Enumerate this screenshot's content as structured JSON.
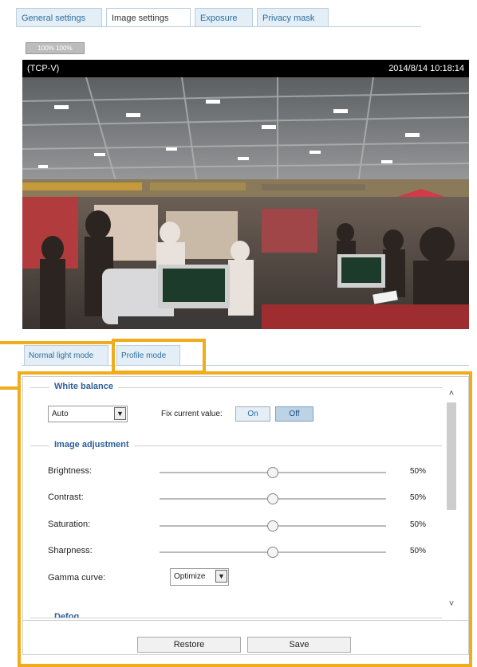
{
  "tabs": [
    {
      "label": "General settings",
      "active": false
    },
    {
      "label": "Image settings",
      "active": true
    },
    {
      "label": "Exposure",
      "active": false
    },
    {
      "label": "Privacy mask",
      "active": false
    }
  ],
  "video": {
    "zoom_badge": "100% 100%",
    "stream_label": "(TCP-V)",
    "timestamp": "2014/8/14 10:18:14"
  },
  "mode_tabs": [
    {
      "label": "Normal light mode",
      "active": false
    },
    {
      "label": "Profile mode",
      "active": true
    }
  ],
  "white_balance": {
    "title": "White balance",
    "select_value": "Auto",
    "fix_label": "Fix current value:",
    "on_label": "On",
    "off_label": "Off",
    "selected": "Off"
  },
  "image_adjustment": {
    "title": "Image adjustment",
    "rows": [
      {
        "label": "Brightness:",
        "value": "50%",
        "level": 0.5
      },
      {
        "label": "Contrast:",
        "value": "50%",
        "level": 0.5
      },
      {
        "label": "Saturation:",
        "value": "50%",
        "level": 0.5
      },
      {
        "label": "Sharpness:",
        "value": "50%",
        "level": 0.5
      }
    ],
    "gamma_label": "Gamma curve:",
    "gamma_value": "Optimize"
  },
  "defog_title": "Defog",
  "buttons": {
    "restore": "Restore",
    "save": "Save"
  },
  "colors": {
    "highlight": "#f0ac1b",
    "tab_text": "#2f6f9e",
    "section_title": "#2c5f9a"
  }
}
